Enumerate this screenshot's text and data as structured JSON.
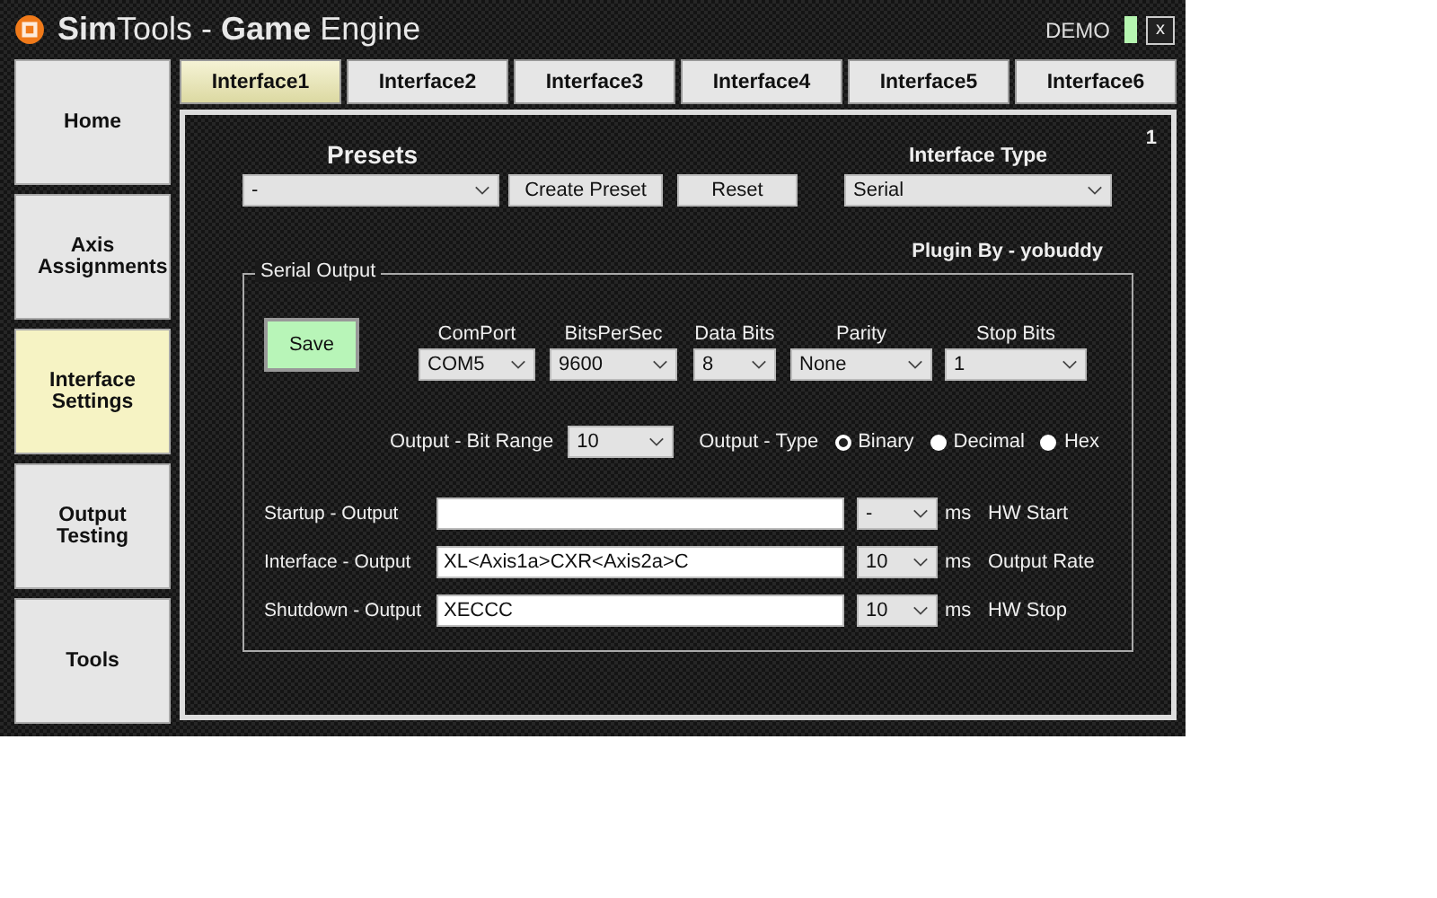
{
  "window": {
    "title": "**Sim**Tools - **Game** Engine",
    "mode": "DEMO",
    "close": "x"
  },
  "sidebar": [
    {
      "label": "Home",
      "selected": false
    },
    {
      "label": "Axis Assignments",
      "selected": false
    },
    {
      "label": "Interface Settings",
      "selected": true
    },
    {
      "label": "Output Testing",
      "selected": false
    },
    {
      "label": "Tools",
      "selected": false
    }
  ],
  "tabs": [
    {
      "label": "Interface1",
      "selected": true
    },
    {
      "label": "Interface2",
      "selected": false
    },
    {
      "label": "Interface3",
      "selected": false
    },
    {
      "label": "Interface4",
      "selected": false
    },
    {
      "label": "Interface5",
      "selected": false
    },
    {
      "label": "Interface6",
      "selected": false
    }
  ],
  "panel_number": "1",
  "presets": {
    "title": "Presets",
    "value": "-",
    "create_button": "Create Preset",
    "reset_button": "Reset"
  },
  "interface_type": {
    "title": "Interface Type",
    "value": "Serial"
  },
  "plugin_credit": "Plugin By - yobuddy",
  "serial_output": {
    "title": "Serial Output",
    "save_button": "Save",
    "settings": [
      {
        "label": "ComPort",
        "value": "COM5"
      },
      {
        "label": "BitsPerSec",
        "value": "9600"
      },
      {
        "label": "Data Bits",
        "value": "8"
      },
      {
        "label": "Parity",
        "value": "None"
      },
      {
        "label": "Stop Bits",
        "value": "1"
      }
    ],
    "bit_range": {
      "label": "Output - Bit Range",
      "value": "10"
    },
    "output_type": {
      "label": "Output - Type",
      "options": [
        {
          "label": "Binary",
          "selected": true
        },
        {
          "label": "Decimal",
          "selected": false
        },
        {
          "label": "Hex",
          "selected": false
        }
      ]
    },
    "outputs": [
      {
        "label": "Startup - Output",
        "delay": "-",
        "unit": "ms",
        "note": "HW Start"
      },
      {
        "label": "Interface - Output",
        "value": "XL<Axis1a>CXR<Axis2a>C",
        "delay": "10",
        "unit": "ms",
        "note": "Output Rate"
      },
      {
        "label": "Shutdown - Output",
        "value": "XECCC",
        "delay": "10",
        "unit": "ms",
        "note": "HW Stop"
      }
    ]
  }
}
